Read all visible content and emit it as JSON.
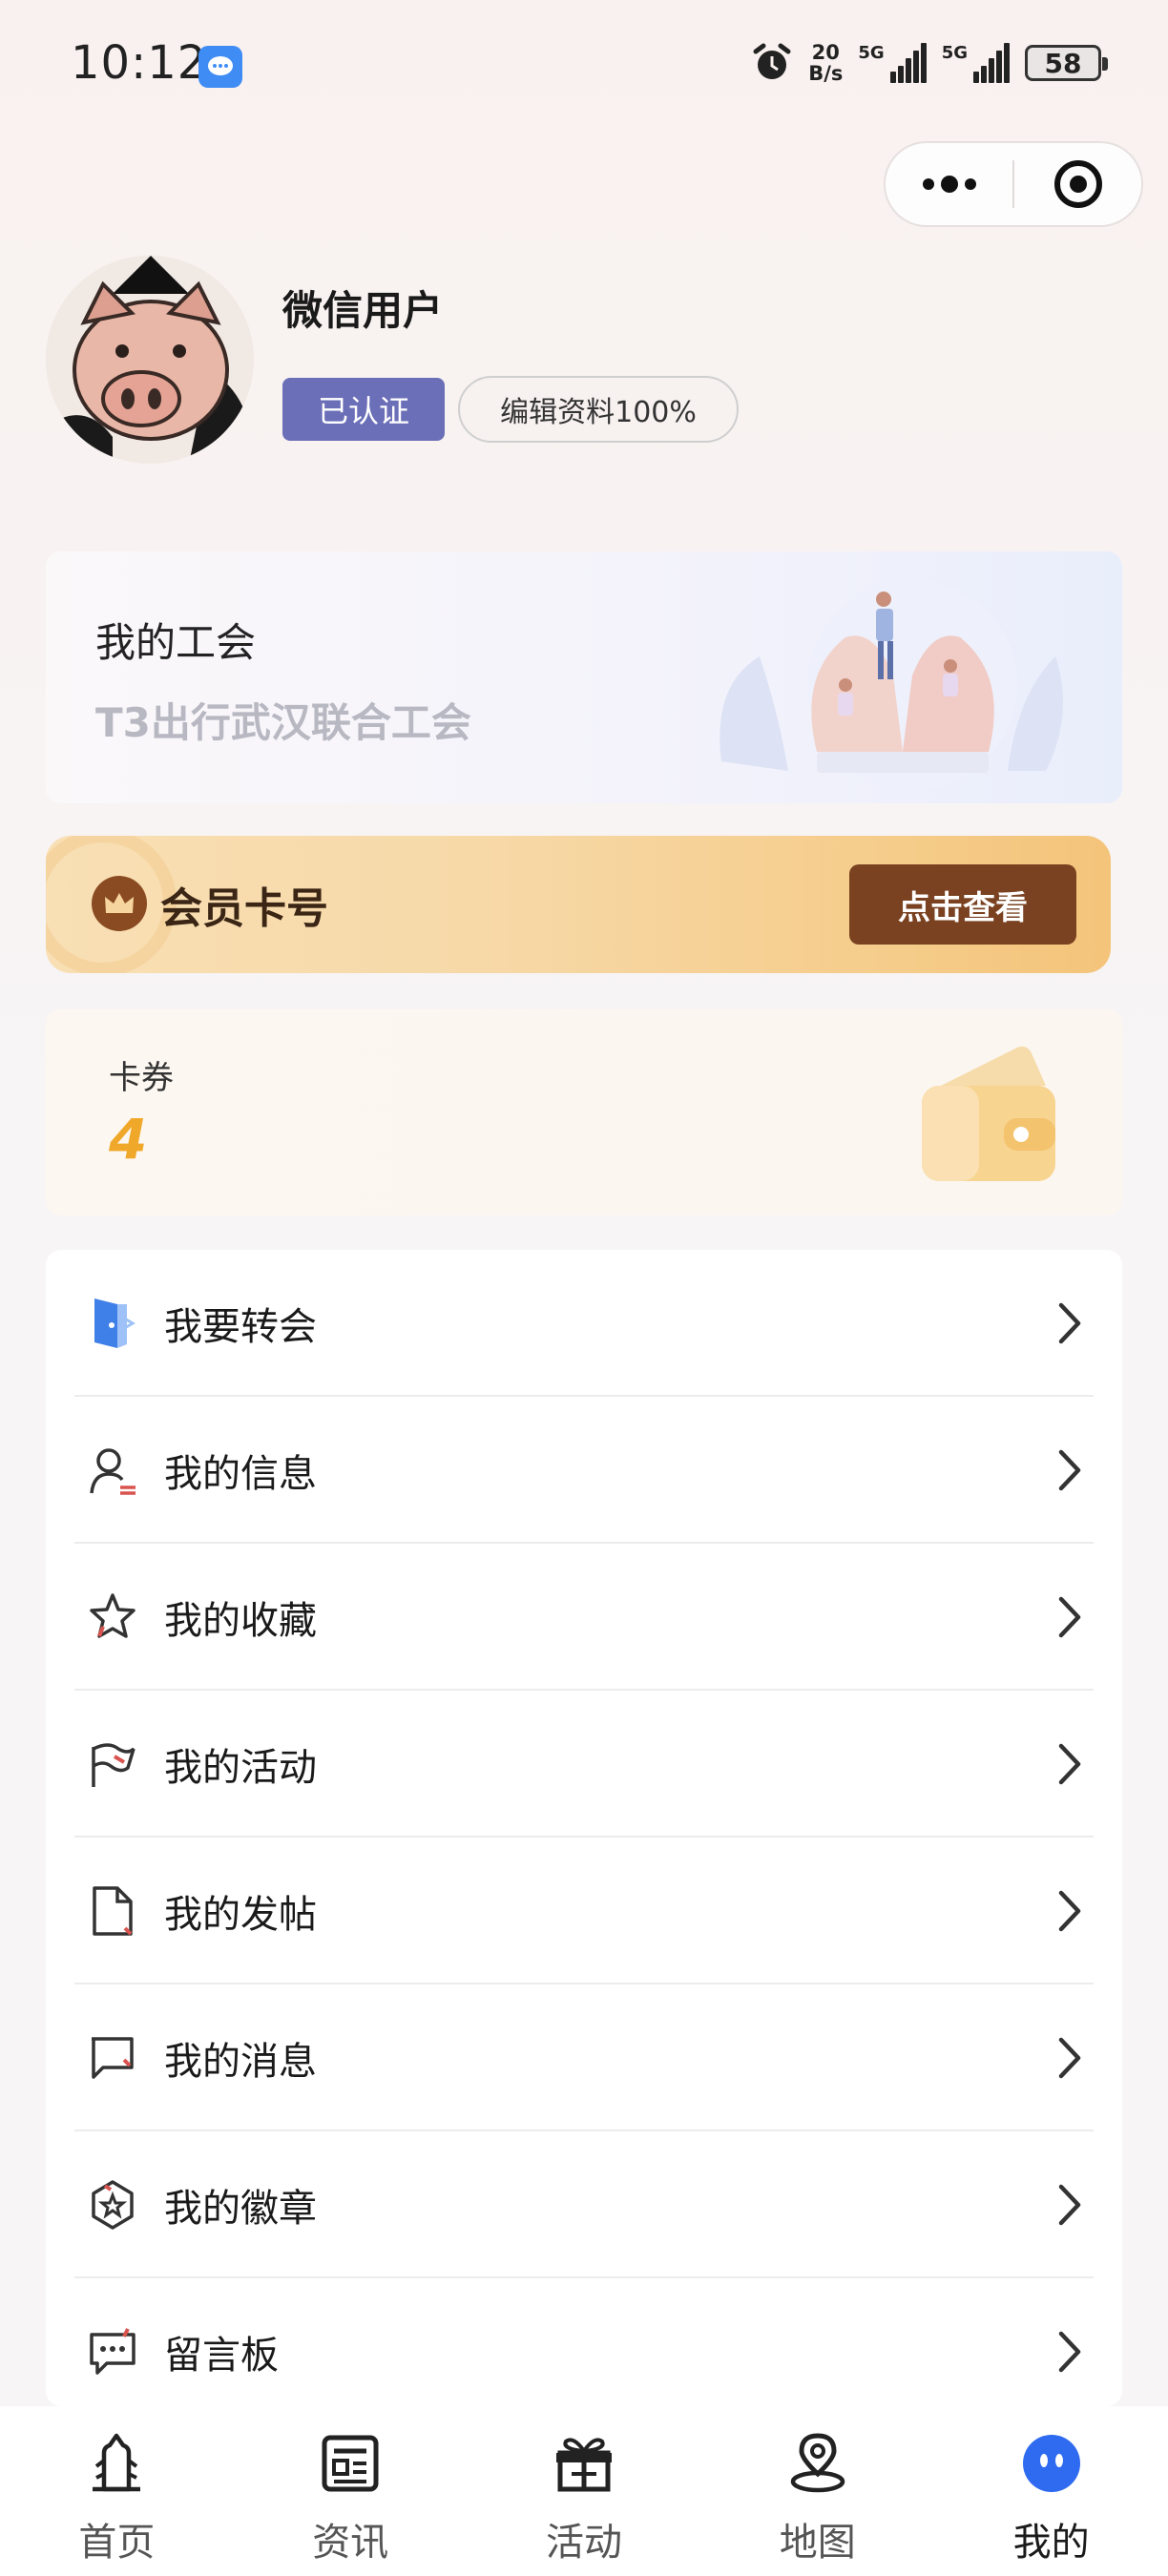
{
  "status_bar": {
    "time": "10:12",
    "net_speed_top": "20",
    "net_speed_bottom": "B/s",
    "signal1": "5G",
    "signal2": "5G",
    "battery": "58"
  },
  "profile": {
    "username": "微信用户",
    "verified_label": "已认证",
    "edit_label": "编辑资料100%"
  },
  "union": {
    "title": "我的工会",
    "name": "T3出行武汉联合工会"
  },
  "member": {
    "label": "会员卡号",
    "button": "点击查看"
  },
  "coupons": {
    "label": "卡券",
    "count": "4"
  },
  "menu": {
    "items": [
      {
        "label": "我要转会",
        "icon": "transfer-door-icon"
      },
      {
        "label": "我的信息",
        "icon": "user-info-icon"
      },
      {
        "label": "我的收藏",
        "icon": "star-icon"
      },
      {
        "label": "我的活动",
        "icon": "flag-icon"
      },
      {
        "label": "我的发帖",
        "icon": "document-icon"
      },
      {
        "label": "我的消息",
        "icon": "chat-bubble-icon"
      },
      {
        "label": "我的徽章",
        "icon": "badge-icon"
      },
      {
        "label": "留言板",
        "icon": "message-board-icon"
      }
    ]
  },
  "tabs": [
    {
      "label": "首页",
      "icon": "home-icon"
    },
    {
      "label": "资讯",
      "icon": "news-icon"
    },
    {
      "label": "活动",
      "icon": "gift-icon"
    },
    {
      "label": "地图",
      "icon": "map-pin-icon"
    },
    {
      "label": "我的",
      "icon": "profile-icon",
      "active": true
    }
  ],
  "colors": {
    "accent_purple": "#6b6fb8",
    "member_brown": "#7a4221",
    "coupon_orange": "#f0a82a",
    "active_tab_blue": "#2f6bf0"
  }
}
